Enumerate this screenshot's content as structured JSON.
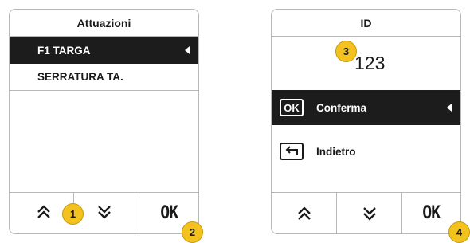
{
  "left_screen": {
    "title": "Attuazioni",
    "items": [
      {
        "label": "F1 TARGA",
        "selected": true
      },
      {
        "label": "SERRATURA TA.",
        "selected": false
      }
    ],
    "buttons": {
      "up_icon": "double-chevron-up",
      "down_icon": "double-chevron-down",
      "ok_label": "OK"
    }
  },
  "right_screen": {
    "title": "ID",
    "value": "123",
    "actions": [
      {
        "icon": "OK",
        "label": "Conferma",
        "selected": true
      },
      {
        "icon": "back-arrow",
        "label": "Indietro",
        "selected": false
      }
    ],
    "buttons": {
      "up_icon": "double-chevron-up",
      "down_icon": "double-chevron-down",
      "ok_label": "OK"
    }
  },
  "callouts": [
    "1",
    "2",
    "3",
    "4"
  ],
  "colors": {
    "selected_bg": "#1c1c1c",
    "badge": "#f4c21f",
    "border": "#b8b8b8"
  }
}
